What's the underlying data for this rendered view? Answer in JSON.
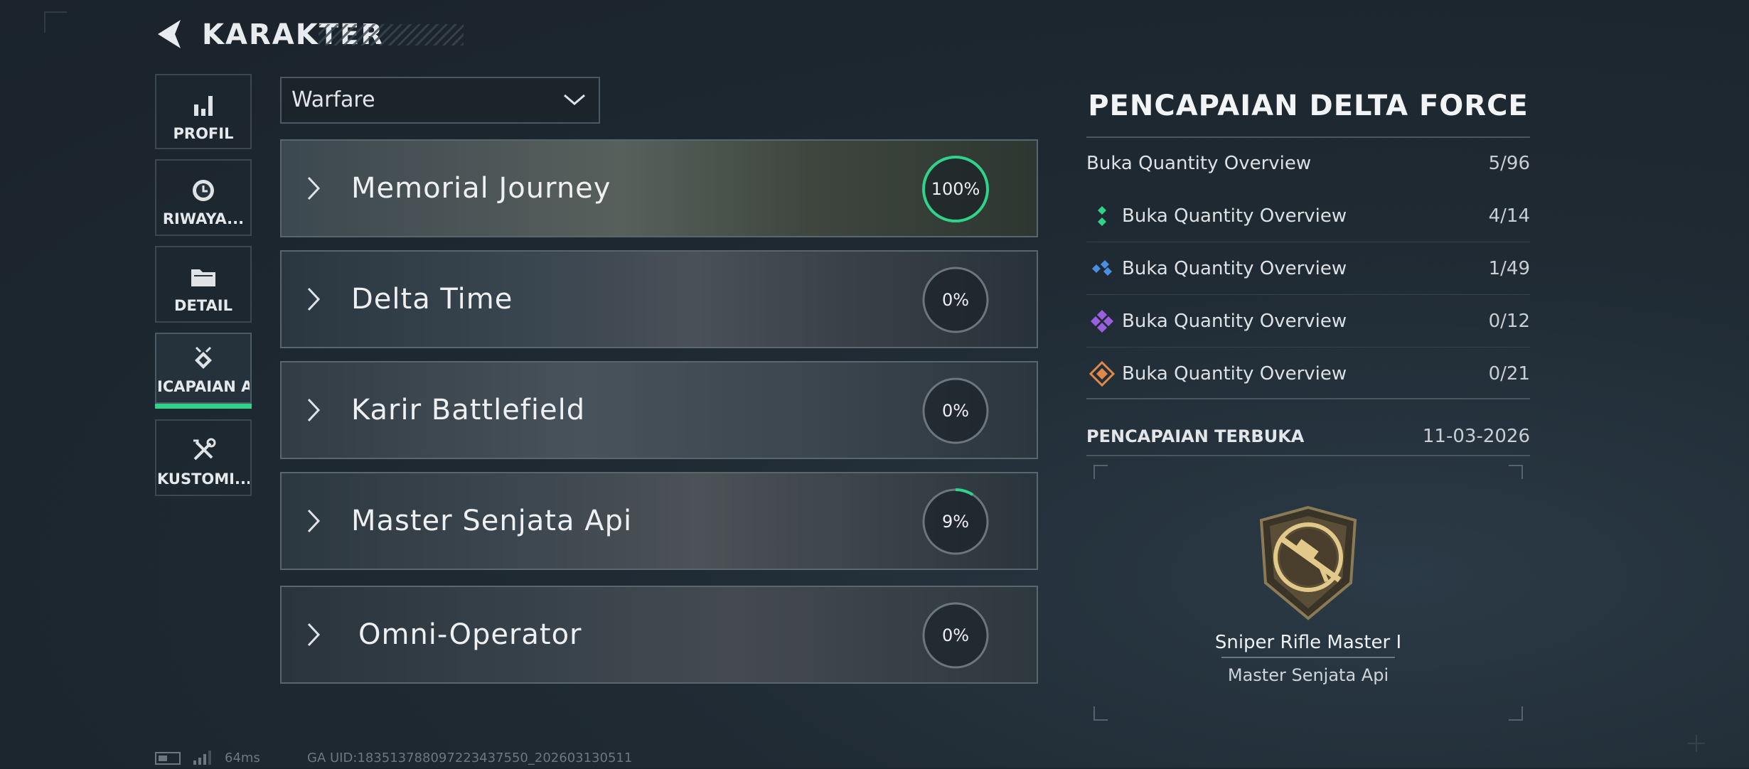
{
  "header": {
    "title": "KARAKTER"
  },
  "sidebar": {
    "items": [
      {
        "label": "PROFIL",
        "icon": "stats-icon"
      },
      {
        "label": "RIWAYA...",
        "icon": "history-icon"
      },
      {
        "label": "DETAIL",
        "icon": "folder-icon"
      },
      {
        "label": "ICAPAIAN AI",
        "icon": "achievement-icon",
        "active": true
      },
      {
        "label": "KUSTOMI...",
        "icon": "tools-icon"
      }
    ]
  },
  "filter": {
    "selected": "Warfare"
  },
  "categories": [
    {
      "name": "Memorial Journey",
      "progress_label": "100%",
      "progress": 1.0
    },
    {
      "name": "Delta Time",
      "progress_label": "0%",
      "progress": 0.0
    },
    {
      "name": "Karir Battlefield",
      "progress_label": "0%",
      "progress": 0.0
    },
    {
      "name": "Master Senjata Api",
      "progress_label": "9%",
      "progress": 0.09
    },
    {
      "name": "Omni-Operator",
      "progress_label": "0%",
      "progress": 0.0
    }
  ],
  "panel": {
    "title": "PENCAPAIAN DELTA FORCE",
    "overview": {
      "label": "Buka Quantity Overview",
      "count": "5/96"
    },
    "tiers": [
      {
        "label": "Buka Quantity Overview",
        "count": "4/14",
        "color": "#2fd48a"
      },
      {
        "label": "Buka Quantity Overview",
        "count": "1/49",
        "color": "#4a8ee6"
      },
      {
        "label": "Buka Quantity Overview",
        "count": "0/12",
        "color": "#9b5fe0"
      },
      {
        "label": "Buka Quantity Overview",
        "count": "0/21",
        "color": "#e0874a"
      }
    ],
    "unlocked_label": "PENCAPAIAN TERBUKA",
    "unlocked_date": "11-03-2026",
    "badge": {
      "name": "Sniper Rifle Master I",
      "category": "Master Senjata Api"
    }
  },
  "footer": {
    "ping": "64ms",
    "uid": "GA UID:1835137880972234375​50_202603130511"
  },
  "colors": {
    "accent": "#2fd48a"
  }
}
